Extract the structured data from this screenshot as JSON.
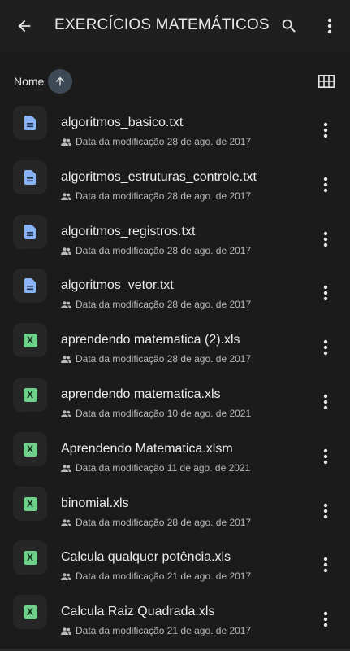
{
  "appbar": {
    "title": "EXERCÍCIOS MATEMÁTICOS",
    "back_icon": "arrow-back-icon",
    "search_icon": "search-icon",
    "more_icon": "more-vert-icon"
  },
  "sort": {
    "label": "Nome",
    "direction_icon": "arrow-up-icon",
    "view_toggle_icon": "grid-view-icon"
  },
  "colors": {
    "background": "#1b1b1b",
    "appbar": "#1f1f1f",
    "doc_icon": "#8ab4f8",
    "sheet_icon": "#6fd08c",
    "sort_chip": "#3d4a56"
  },
  "files": [
    {
      "name": "algoritmos_basico.txt",
      "type": "doc",
      "meta": "Data da modificação 28 de ago. de 2017"
    },
    {
      "name": "algoritmos_estruturas_controle.txt",
      "type": "doc",
      "meta": "Data da modificação 28 de ago. de 2017"
    },
    {
      "name": "algoritmos_registros.txt",
      "type": "doc",
      "meta": "Data da modificação 28 de ago. de 2017"
    },
    {
      "name": "algoritmos_vetor.txt",
      "type": "doc",
      "meta": "Data da modificação 28 de ago. de 2017"
    },
    {
      "name": "aprendendo matematica (2).xls",
      "type": "sheet",
      "meta": "Data da modificação 28 de ago. de 2017"
    },
    {
      "name": "aprendendo matematica.xls",
      "type": "sheet",
      "meta": "Data da modificação 10 de ago. de 2021"
    },
    {
      "name": "Aprendendo Matematica.xlsm",
      "type": "sheet",
      "meta": "Data da modificação 11 de ago. de 2021"
    },
    {
      "name": "binomial.xls",
      "type": "sheet",
      "meta": "Data da modificação 28 de ago. de 2017"
    },
    {
      "name": "Calcula qualquer potência.xls",
      "type": "sheet",
      "meta": "Data da modificação 21 de ago. de 2017"
    },
    {
      "name": "Calcula Raiz Quadrada.xls",
      "type": "sheet",
      "meta": "Data da modificação 21 de ago. de 2017"
    }
  ],
  "sheet_icon_letter": "X"
}
